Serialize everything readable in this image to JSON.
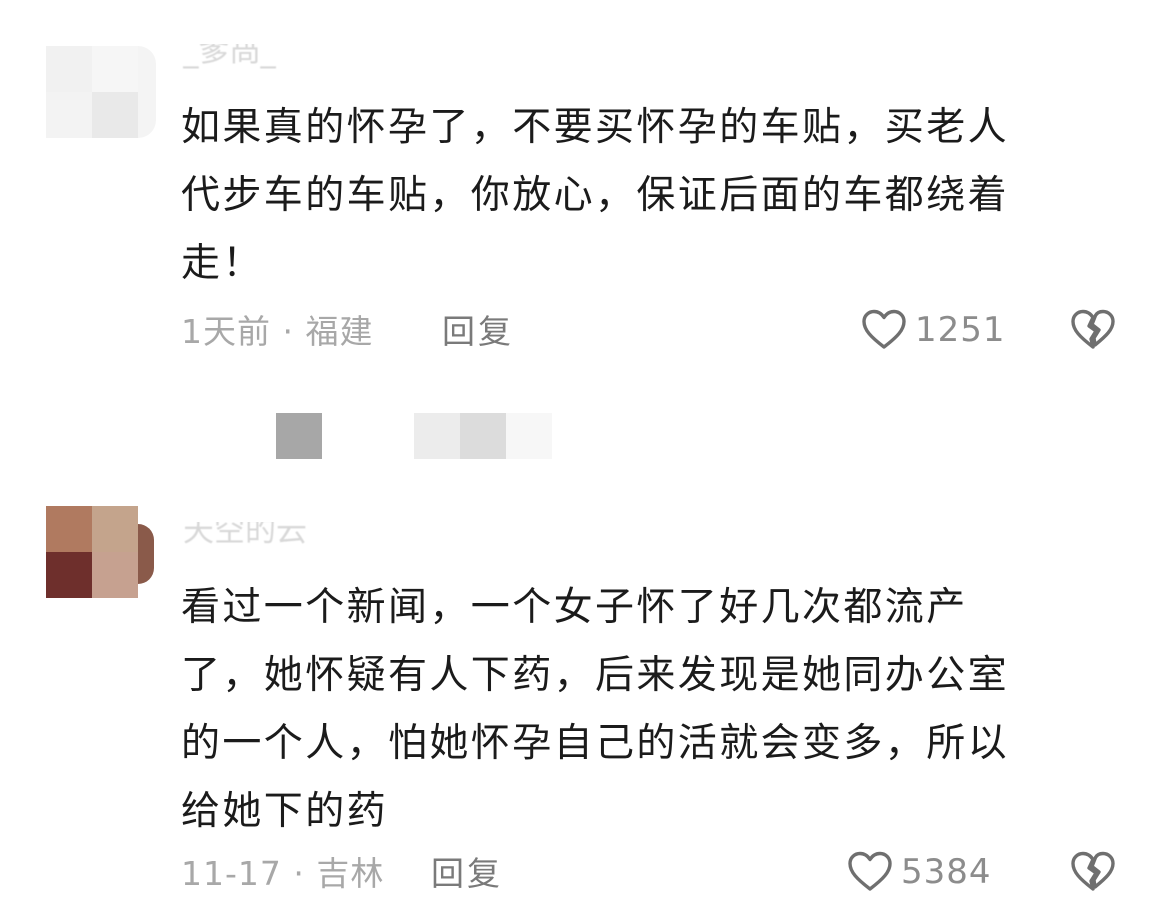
{
  "comments": [
    {
      "username": "_爹咼_",
      "body_lines": [
        "如果真的怀孕了，不要买怀孕的车贴，买老人",
        "代步车的车贴，你放心，保证后面的车都绕着",
        "走！"
      ],
      "time_location": "1天前 · 福建",
      "reply_label": "回复",
      "like_count": "1251",
      "avatar_colors": [
        "#f1f1f1",
        "#f6f6f6",
        "#f3f3f3",
        "#e9e9e9"
      ]
    },
    {
      "username": "天空的云",
      "body_lines": [
        "看过一个新闻，一个女子怀了好几次都流产",
        "了，她怀疑有人下药，后来发现是她同办公室",
        "的一个人，怕她怀孕自己的活就会变多，所以",
        "给她下的药"
      ],
      "time_location": "11-17 · 吉林",
      "reply_label": "回复",
      "like_count": "5384",
      "avatar_colors": [
        "#b07a60",
        "#c4a48c",
        "#6e2f2c",
        "#c6a190"
      ]
    }
  ],
  "icons": {
    "like": "heart-outline-icon",
    "dislike": "broken-heart-icon"
  },
  "colors": {
    "text_primary": "#1b1b1b",
    "text_meta": "#a8a8a8",
    "reply": "#7a7a7a",
    "like_count": "#8c8c8c",
    "icon": "#6f6f6f"
  }
}
